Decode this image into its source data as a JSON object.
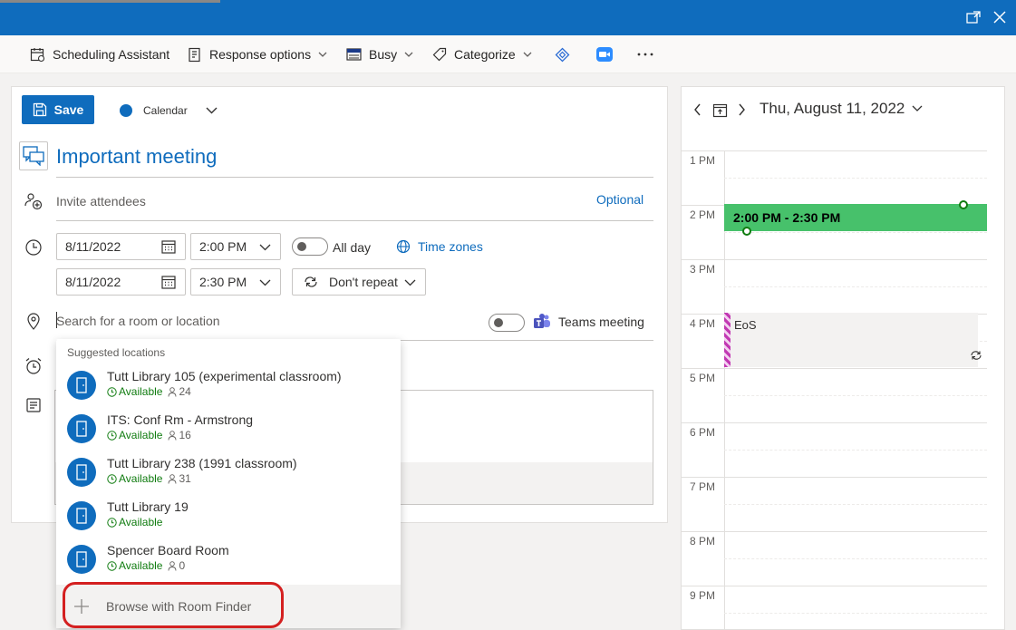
{
  "toolbar": {
    "items": [
      {
        "label": "Scheduling Assistant",
        "icon": "scheduling-assistant-icon"
      },
      {
        "label": "Response options",
        "icon": "response-options-icon"
      },
      {
        "label": "Busy",
        "icon": "busy-status-icon"
      },
      {
        "label": "Categorize",
        "icon": "tag-icon"
      }
    ]
  },
  "form": {
    "save_label": "Save",
    "calendar_label": "Calendar",
    "title": "Important meeting",
    "invite_placeholder": "Invite attendees",
    "optional_label": "Optional",
    "start_date": "8/11/2022",
    "start_time": "2:00 PM",
    "end_date": "8/11/2022",
    "end_time": "2:30 PM",
    "all_day_label": "All day",
    "time_zones_label": "Time zones",
    "repeat_label": "Don't repeat",
    "location_placeholder": "Search for a room or location",
    "teams_label": "Teams meeting"
  },
  "suggestions": {
    "header": "Suggested locations",
    "items": [
      {
        "name": "Tutt Library 105 (experimental classroom)",
        "status": "Available",
        "capacity": "24"
      },
      {
        "name": "ITS: Conf Rm - Armstrong",
        "status": "Available",
        "capacity": "16"
      },
      {
        "name": "Tutt Library 238 (1991 classroom)",
        "status": "Available",
        "capacity": "31"
      },
      {
        "name": "Tutt Library 19",
        "status": "Available",
        "capacity": ""
      },
      {
        "name": "Spencer Board Room",
        "status": "Available",
        "capacity": "0"
      }
    ],
    "browse_label": "Browse with Room Finder"
  },
  "day_view": {
    "date": "Thu, August 11, 2022",
    "hours": [
      "1 PM",
      "2 PM",
      "3 PM",
      "4 PM",
      "5 PM",
      "6 PM",
      "7 PM",
      "8 PM",
      "9 PM"
    ],
    "new_event_label": "2:00 PM - 2:30 PM",
    "existing_event_title": "EoS"
  },
  "colors": {
    "brand": "#0f6cbd",
    "new_event": "#47c16b",
    "available": "#107c10",
    "highlight_ring": "#d42020"
  }
}
